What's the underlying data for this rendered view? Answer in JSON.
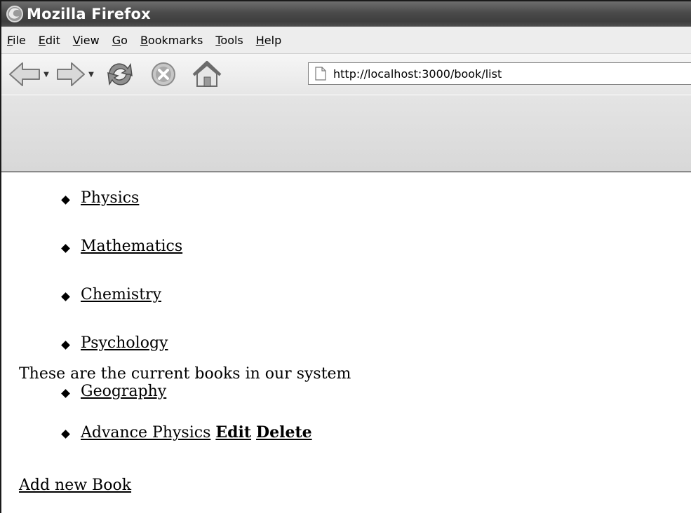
{
  "window": {
    "title": "Mozilla Firefox"
  },
  "menubar": {
    "items": [
      {
        "accel": "F",
        "rest": "ile"
      },
      {
        "accel": "E",
        "rest": "dit"
      },
      {
        "accel": "V",
        "rest": "iew"
      },
      {
        "accel": "G",
        "rest": "o"
      },
      {
        "accel": "B",
        "rest": "ookmarks"
      },
      {
        "accel": "T",
        "rest": "ools"
      },
      {
        "accel": "H",
        "rest": "elp"
      }
    ]
  },
  "navbar": {
    "back_icon": "back-arrow-icon",
    "forward_icon": "forward-arrow-icon",
    "reload_icon": "reload-icon",
    "stop_icon": "stop-icon",
    "home_icon": "home-icon",
    "url": "http://localhost:3000/book/list"
  },
  "content": {
    "categories": [
      "Physics",
      "Mathematics",
      "Chemistry",
      "Psychology",
      "Geography"
    ],
    "intro": "These are the current books in our system",
    "books": [
      {
        "title": "Advance Physics",
        "edit_label": "Edit",
        "delete_label": "Delete"
      }
    ],
    "add_link": "Add new Book"
  }
}
